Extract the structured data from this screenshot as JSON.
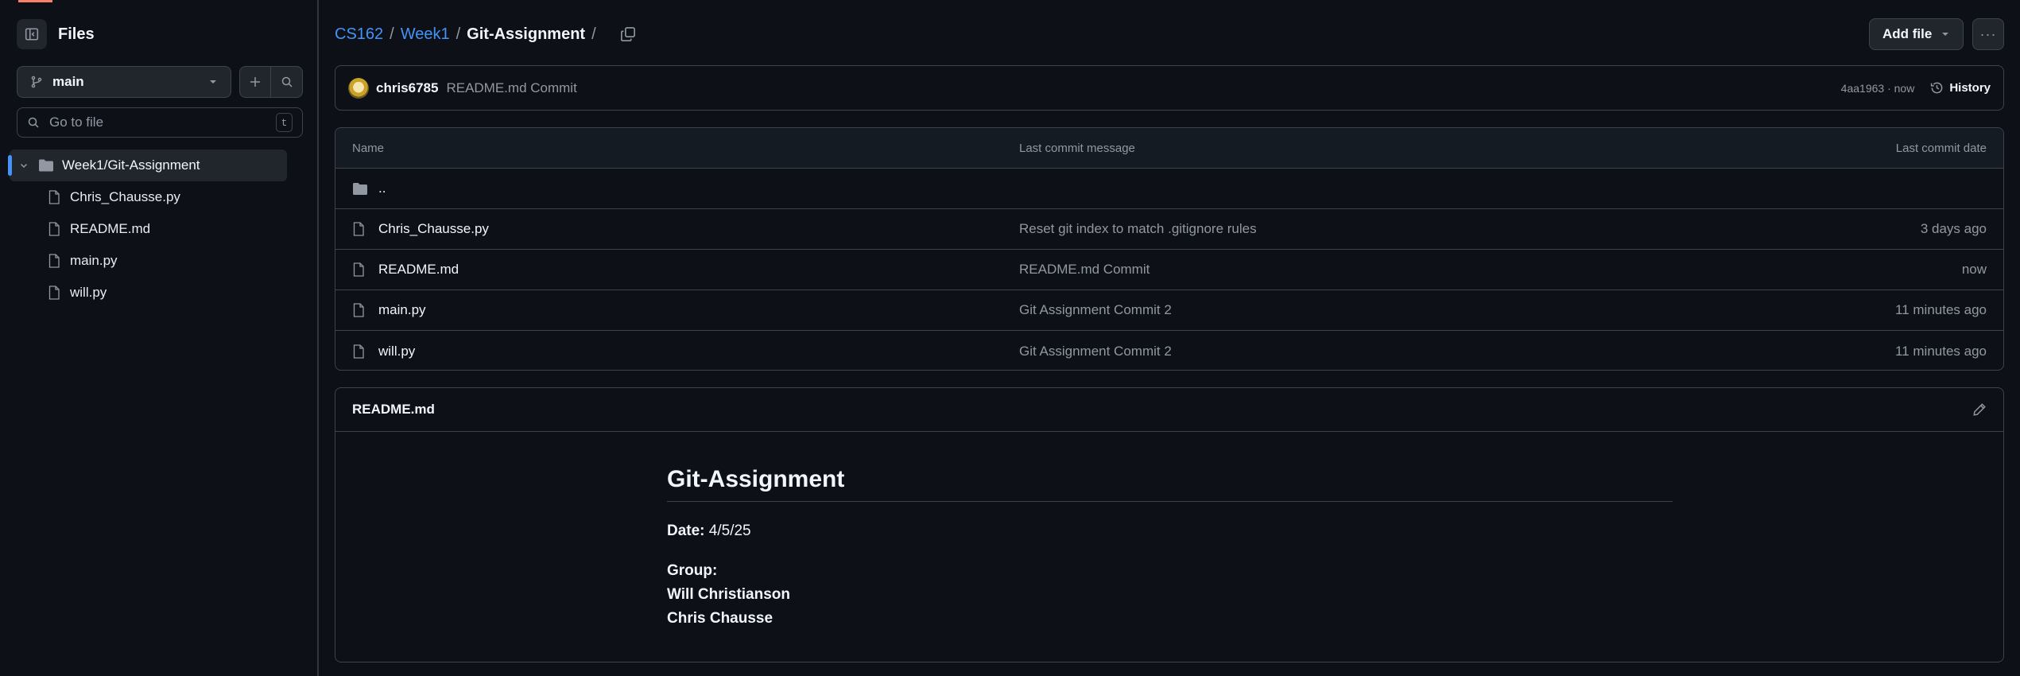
{
  "sidebar": {
    "title": "Files",
    "branch": "main",
    "goto_placeholder": "Go to file",
    "goto_shortcut": "t",
    "folder": "Week1/Git-Assignment",
    "files": [
      "Chris_Chausse.py",
      "README.md",
      "main.py",
      "will.py"
    ]
  },
  "breadcrumb": {
    "parts": [
      "CS162",
      "Week1",
      "Git-Assignment"
    ],
    "separator": "/"
  },
  "toolbar": {
    "add_file_label": "Add file",
    "more_label": "···"
  },
  "latest_commit": {
    "author": "chris6785",
    "message": "README.md Commit",
    "hash_time": "4aa1963 · now",
    "history_label": "History"
  },
  "table": {
    "headers": {
      "name": "Name",
      "message": "Last commit message",
      "date": "Last commit date"
    },
    "parent_dir": "..",
    "rows": [
      {
        "name": "Chris_Chausse.py",
        "message": "Reset git index to match .gitignore rules",
        "date": "3 days ago"
      },
      {
        "name": "README.md",
        "message": "README.md Commit",
        "date": "now"
      },
      {
        "name": "main.py",
        "message": "Git Assignment Commit 2",
        "date": "11 minutes ago"
      },
      {
        "name": "will.py",
        "message": "Git Assignment Commit 2",
        "date": "11 minutes ago"
      }
    ]
  },
  "readme": {
    "filename": "README.md",
    "heading": "Git-Assignment",
    "date_label": "Date:",
    "date_value": "4/5/25",
    "group_label": "Group:",
    "members": [
      "Will Christianson",
      "Chris Chausse"
    ]
  },
  "colors": {
    "background": "#0d1117",
    "accent_link": "#4493f8",
    "border": "#3d444d",
    "muted_text": "#9198a1"
  }
}
